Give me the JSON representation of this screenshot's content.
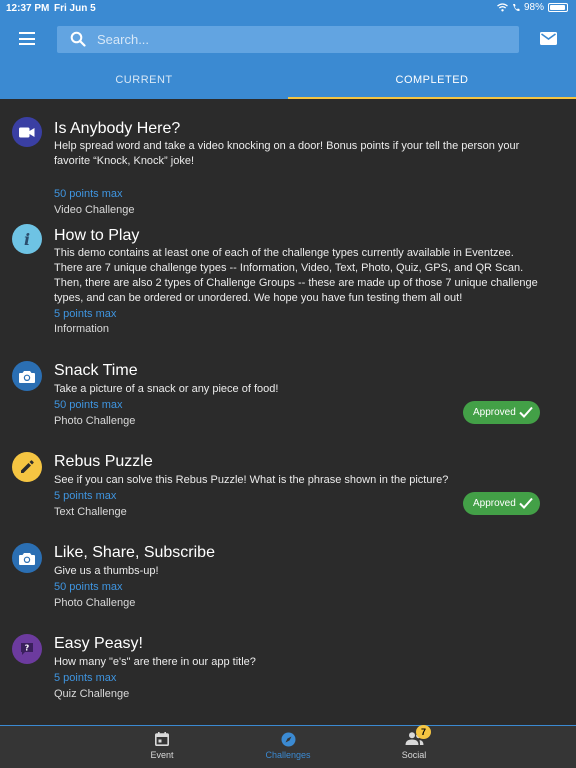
{
  "status_bar": {
    "time": "12:37 PM",
    "date": "Fri Jun 5",
    "battery": "98%"
  },
  "header": {
    "search_placeholder": "Search..."
  },
  "tabs": [
    {
      "label": "CURRENT"
    },
    {
      "label": "COMPLETED"
    }
  ],
  "challenges": [
    {
      "title": "Is Anybody Here?",
      "description": "Help spread word and take a video knocking on a door! Bonus points if your tell the person your favorite “Knock, Knock” joke!",
      "points": "50 points max",
      "type": "Video Challenge",
      "icon": "video-camera-icon",
      "icon_color": "#3a3fa3",
      "status": ""
    },
    {
      "title": "How to Play",
      "description": "This demo contains at least one of each of the challenge types currently available in Eventzee. There are 7 unique challenge types -- Information, Video, Text, Photo, Quiz, GPS, and QR Scan. Then, there are also 2 types of Challenge Groups -- these are made up of those 7 unique challenge types, and can be ordered or unordered. We hope you have fun testing them all out!",
      "points": "5 points max",
      "type": "Information",
      "icon": "info-icon",
      "icon_color": "#6ec3e4",
      "status": ""
    },
    {
      "title": "Snack Time",
      "description": "Take a picture of a snack or any piece of food!",
      "points": "50 points max",
      "type": "Photo Challenge",
      "icon": "camera-icon",
      "icon_color": "#2b6fb3",
      "status": "Approved"
    },
    {
      "title": "Rebus Puzzle",
      "description": "See if you can solve this Rebus Puzzle! What is the phrase shown in the picture?",
      "points": "5 points max",
      "type": "Text Challenge",
      "icon": "pencil-icon",
      "icon_color": "#f5c542",
      "status": "Approved"
    },
    {
      "title": "Like, Share, Subscribe",
      "description": "Give us a thumbs-up!",
      "points": "50 points max",
      "type": "Photo Challenge",
      "icon": "camera-icon",
      "icon_color": "#2b6fb3",
      "status": ""
    },
    {
      "title": "Easy Peasy!",
      "description": "How many \"e's\" are there in our app title?",
      "points": "5 points max",
      "type": "Quiz Challenge",
      "icon": "question-icon",
      "icon_color": "#6c3b9e",
      "status": ""
    }
  ],
  "bottom_nav": [
    {
      "label": "Event",
      "icon": "calendar-icon"
    },
    {
      "label": "Challenges",
      "icon": "compass-icon"
    },
    {
      "label": "Social",
      "icon": "people-icon",
      "badge": "7"
    }
  ],
  "colors": {
    "primary": "#3b8ad2",
    "accent": "#f5c542",
    "approved": "#43a047",
    "background": "#2b2b2b"
  }
}
